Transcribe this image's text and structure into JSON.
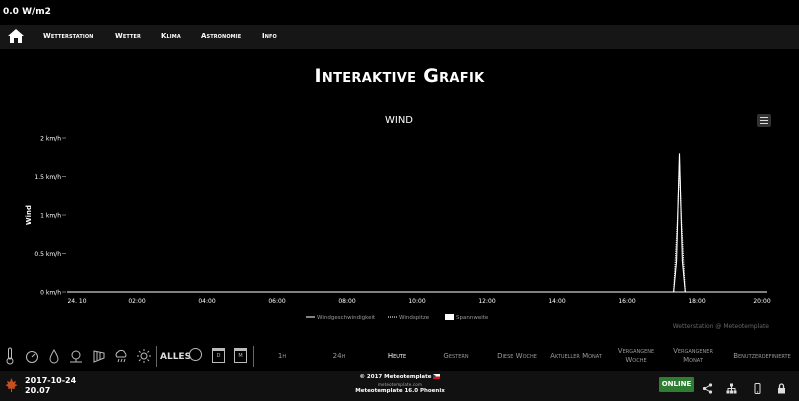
{
  "header": {
    "solar_reading": "0.0 W/m2"
  },
  "nav": {
    "items": [
      {
        "label": "Wetterstation"
      },
      {
        "label": "Wetter"
      },
      {
        "label": "Klima"
      },
      {
        "label": "Astronomie"
      },
      {
        "label": "Info"
      }
    ]
  },
  "page": {
    "title": "Interaktive Grafik"
  },
  "chart_data": {
    "type": "line",
    "title": "WIND",
    "ylabel": "Wind",
    "xlabel": "",
    "y_unit": "km/h",
    "ylim": [
      0,
      2
    ],
    "y_ticks": [
      "0 km/h",
      "0.5 km/h",
      "1 km/h",
      "1.5 km/h",
      "2 km/h"
    ],
    "x_range": [
      "2017-10-24 00:00",
      "2017-10-24 20:00"
    ],
    "x_ticks": [
      "24. 10",
      "02:00",
      "04:00",
      "06:00",
      "08:00",
      "10:00",
      "12:00",
      "14:00",
      "16:00",
      "18:00",
      "20:00"
    ],
    "grid": false,
    "legend_position": "bottom",
    "series": [
      {
        "name": "Windgeschwindigkeit",
        "style": "solid",
        "color": "#ffffff",
        "points": [
          [
            "2017-10-24 00:00",
            0
          ],
          [
            "2017-10-24 17:20",
            0
          ],
          [
            "2017-10-24 17:25",
            0.4
          ],
          [
            "2017-10-24 17:30",
            1.8
          ],
          [
            "2017-10-24 17:35",
            0.4
          ],
          [
            "2017-10-24 17:40",
            0
          ],
          [
            "2017-10-24 20:00",
            0
          ]
        ]
      },
      {
        "name": "Windspitze",
        "style": "dotted",
        "color": "#ffffff",
        "points": [
          [
            "2017-10-24 00:00",
            0
          ],
          [
            "2017-10-24 17:20",
            0
          ],
          [
            "2017-10-24 17:27",
            1.0
          ],
          [
            "2017-10-24 17:30",
            1.7
          ],
          [
            "2017-10-24 17:33",
            1.0
          ],
          [
            "2017-10-24 17:40",
            0
          ],
          [
            "2017-10-24 20:00",
            0
          ]
        ]
      },
      {
        "name": "Spannweite",
        "style": "area",
        "color": "#ffffff",
        "points": []
      }
    ]
  },
  "chart_credit": "Wetterstation @ Meteotemplate",
  "toolbar": {
    "icons": [
      "thermometer-icon",
      "gauge-icon",
      "humidity-drop-icon",
      "pressure-icon",
      "wind-sock-icon",
      "rain-cloud-icon",
      "sun-icon"
    ],
    "all_label": "ALLES",
    "cal_day": "D",
    "cal_month": "M",
    "periods": [
      {
        "label": "1h",
        "active": false
      },
      {
        "label": "24h",
        "active": false
      },
      {
        "label": "Heute",
        "active": true
      },
      {
        "label": "Gestern",
        "active": false
      },
      {
        "label": "Diese Woche",
        "active": false
      },
      {
        "label": "Aktueller Monat",
        "active": false
      },
      {
        "label": "Vergangene Woche",
        "active": false
      },
      {
        "label": "Vergangener Monat",
        "active": false
      },
      {
        "label": "Benutzerdefinierte",
        "active": false
      }
    ]
  },
  "footer": {
    "date": "2017-10-24",
    "time": "20.07",
    "copyright": "© 2017 Meteotemplate",
    "site": "meteotemplate.com",
    "version": "Meteotemplate 16.0 Phoenix",
    "status": "ONLINE",
    "status_color": "#2e7d32"
  }
}
